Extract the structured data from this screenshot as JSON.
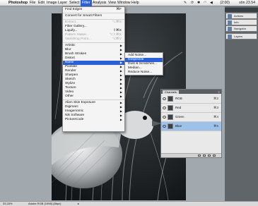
{
  "menubar": {
    "app_name": "Photoshop",
    "items": [
      "File",
      "Edit",
      "Image",
      "Layer",
      "Select",
      "Filter",
      "Analysis",
      "View",
      "Window",
      "Help"
    ],
    "active_item": "Filter",
    "battery": "(2:00)",
    "clock": "sön 23.54"
  },
  "filter_menu": {
    "last_filter": "Find Edges",
    "last_filter_shortcut": "⌘F",
    "convert": "Convert for Smart Filters",
    "extract": "Extract...",
    "extract_shortcut": "⌥⌘X",
    "gallery": "Filter Gallery...",
    "liquify": "Liquify...",
    "liquify_shortcut": "⇧⌘X",
    "pattern_maker": "Pattern Maker...",
    "pattern_maker_shortcut": "⌥⇧⌘X",
    "vanishing_point": "Vanishing Point...",
    "vanishing_point_shortcut": "⌥⌘V",
    "group1": [
      "Artistic",
      "Blur",
      "Brush Strokes",
      "Distort",
      "Noise",
      "Pixelate",
      "Render",
      "Sharpen",
      "Sketch",
      "Stylize",
      "Texture",
      "Video",
      "Other"
    ],
    "highlighted": "Noise",
    "group2": [
      "Alien Skin Exposure",
      "Digimarc",
      "Imagenomic",
      "Nik Software",
      "PictureCode"
    ]
  },
  "noise_submenu": {
    "items": [
      "Add Noise...",
      "Despeckle",
      "Dust & Scratches...",
      "Median...",
      "Reduce Noise..."
    ],
    "highlighted": "Despeckle"
  },
  "dock": {
    "buttons": [
      "Actions",
      "Info",
      "Navigator",
      "Layers"
    ]
  },
  "channels_panel": {
    "tab_label": "Channels",
    "rows": [
      {
        "name": "RGB",
        "key": "⌘2"
      },
      {
        "name": "Red",
        "key": "⌘3"
      },
      {
        "name": "Green",
        "key": "⌘4"
      },
      {
        "name": "Blue",
        "key": "⌘5"
      }
    ],
    "selected": "Blue"
  },
  "statusbar": {
    "zoom": "33,33%",
    "doc_info": "Adobe RGB (1998) (8bpc)",
    "arrow": "▸"
  }
}
